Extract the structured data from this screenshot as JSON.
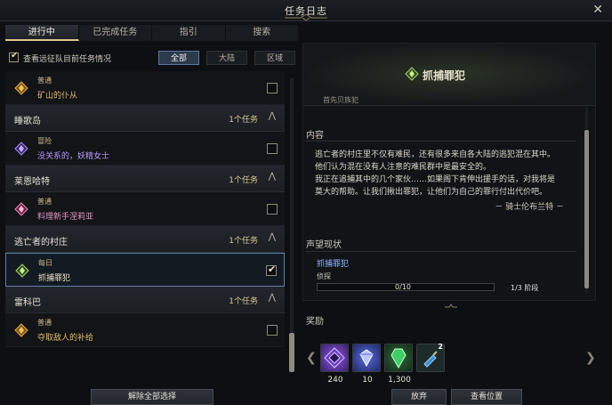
{
  "window": {
    "title": "任务日志"
  },
  "tabs": [
    {
      "label": "进行中",
      "active": true
    },
    {
      "label": "已完成任务",
      "active": false
    },
    {
      "label": "指引",
      "active": false
    },
    {
      "label": "搜索",
      "active": false
    }
  ],
  "filter": {
    "checkbox_label": "查看远征队目前任务情况",
    "checked": true,
    "segments": [
      {
        "label": "全部",
        "active": true
      },
      {
        "label": "大陆",
        "active": false
      },
      {
        "label": "区域",
        "active": false
      }
    ]
  },
  "quest_list": {
    "items": [
      {
        "kind": "quest",
        "type": "普通",
        "name": "矿山的仆从",
        "checked": false,
        "color": "#e3b96a"
      },
      {
        "kind": "region",
        "name": "睡歌岛",
        "count": "1个任务"
      },
      {
        "kind": "quest",
        "type": "冒险",
        "name": "没关系的，妖精女士",
        "checked": false,
        "color": "#b996ff"
      },
      {
        "kind": "region",
        "name": "莱恩哈特",
        "count": "1个任务"
      },
      {
        "kind": "quest",
        "type": "普通",
        "name": "料理新手涅莉亚",
        "checked": false,
        "color": "#e895c2"
      },
      {
        "kind": "region",
        "name": "逃亡者的村庄",
        "count": "1个任务"
      },
      {
        "kind": "quest",
        "type": "每日",
        "name": "抓捕罪犯",
        "checked": true,
        "selected": true,
        "color": "#e8e3c8"
      },
      {
        "kind": "region",
        "name": "雷科巴",
        "count": "1个任务"
      },
      {
        "kind": "quest",
        "type": "普通",
        "name": "夺取敌人的补给",
        "checked": false,
        "color": "#e3b96a"
      }
    ],
    "clear_button": "解除全部选择"
  },
  "detail": {
    "title": "抓捕罪犯",
    "subtitle": "首先贝族犯",
    "content_heading": "内容",
    "content_lines": [
      "逃亡者的村庄里不仅有难民，还有很多来自各大陆的逃犯混在其中。",
      "他们认为混在没有人注意的难民群中是最安全的。",
      "我正在追捕其中的几个家伙……如果阁下肯伸出援手的话，对我将是",
      "莫大的帮助。让我们揪出罪犯，让他们为自己的罪行付出代价吧。"
    ],
    "signature": "－ 骑士伦布兰特 －",
    "rep_heading": "声望现状",
    "rep_name": "抓捕罪犯",
    "rep_stage": "侦探",
    "rep_progress": "0/10",
    "rep_fraction": 0,
    "rep_tier": "1/3 阶段",
    "reward_heading": "奖励",
    "rewards": [
      {
        "icon": "purple-gem-icon",
        "qty": "240"
      },
      {
        "icon": "crystal-icon",
        "qty": "10"
      },
      {
        "icon": "green-crystal-icon",
        "qty": "1,300"
      },
      {
        "icon": "potion-icon",
        "qty": "",
        "badge": "2"
      }
    ],
    "abandon_button": "放弃",
    "locate_button": "查看位置"
  }
}
